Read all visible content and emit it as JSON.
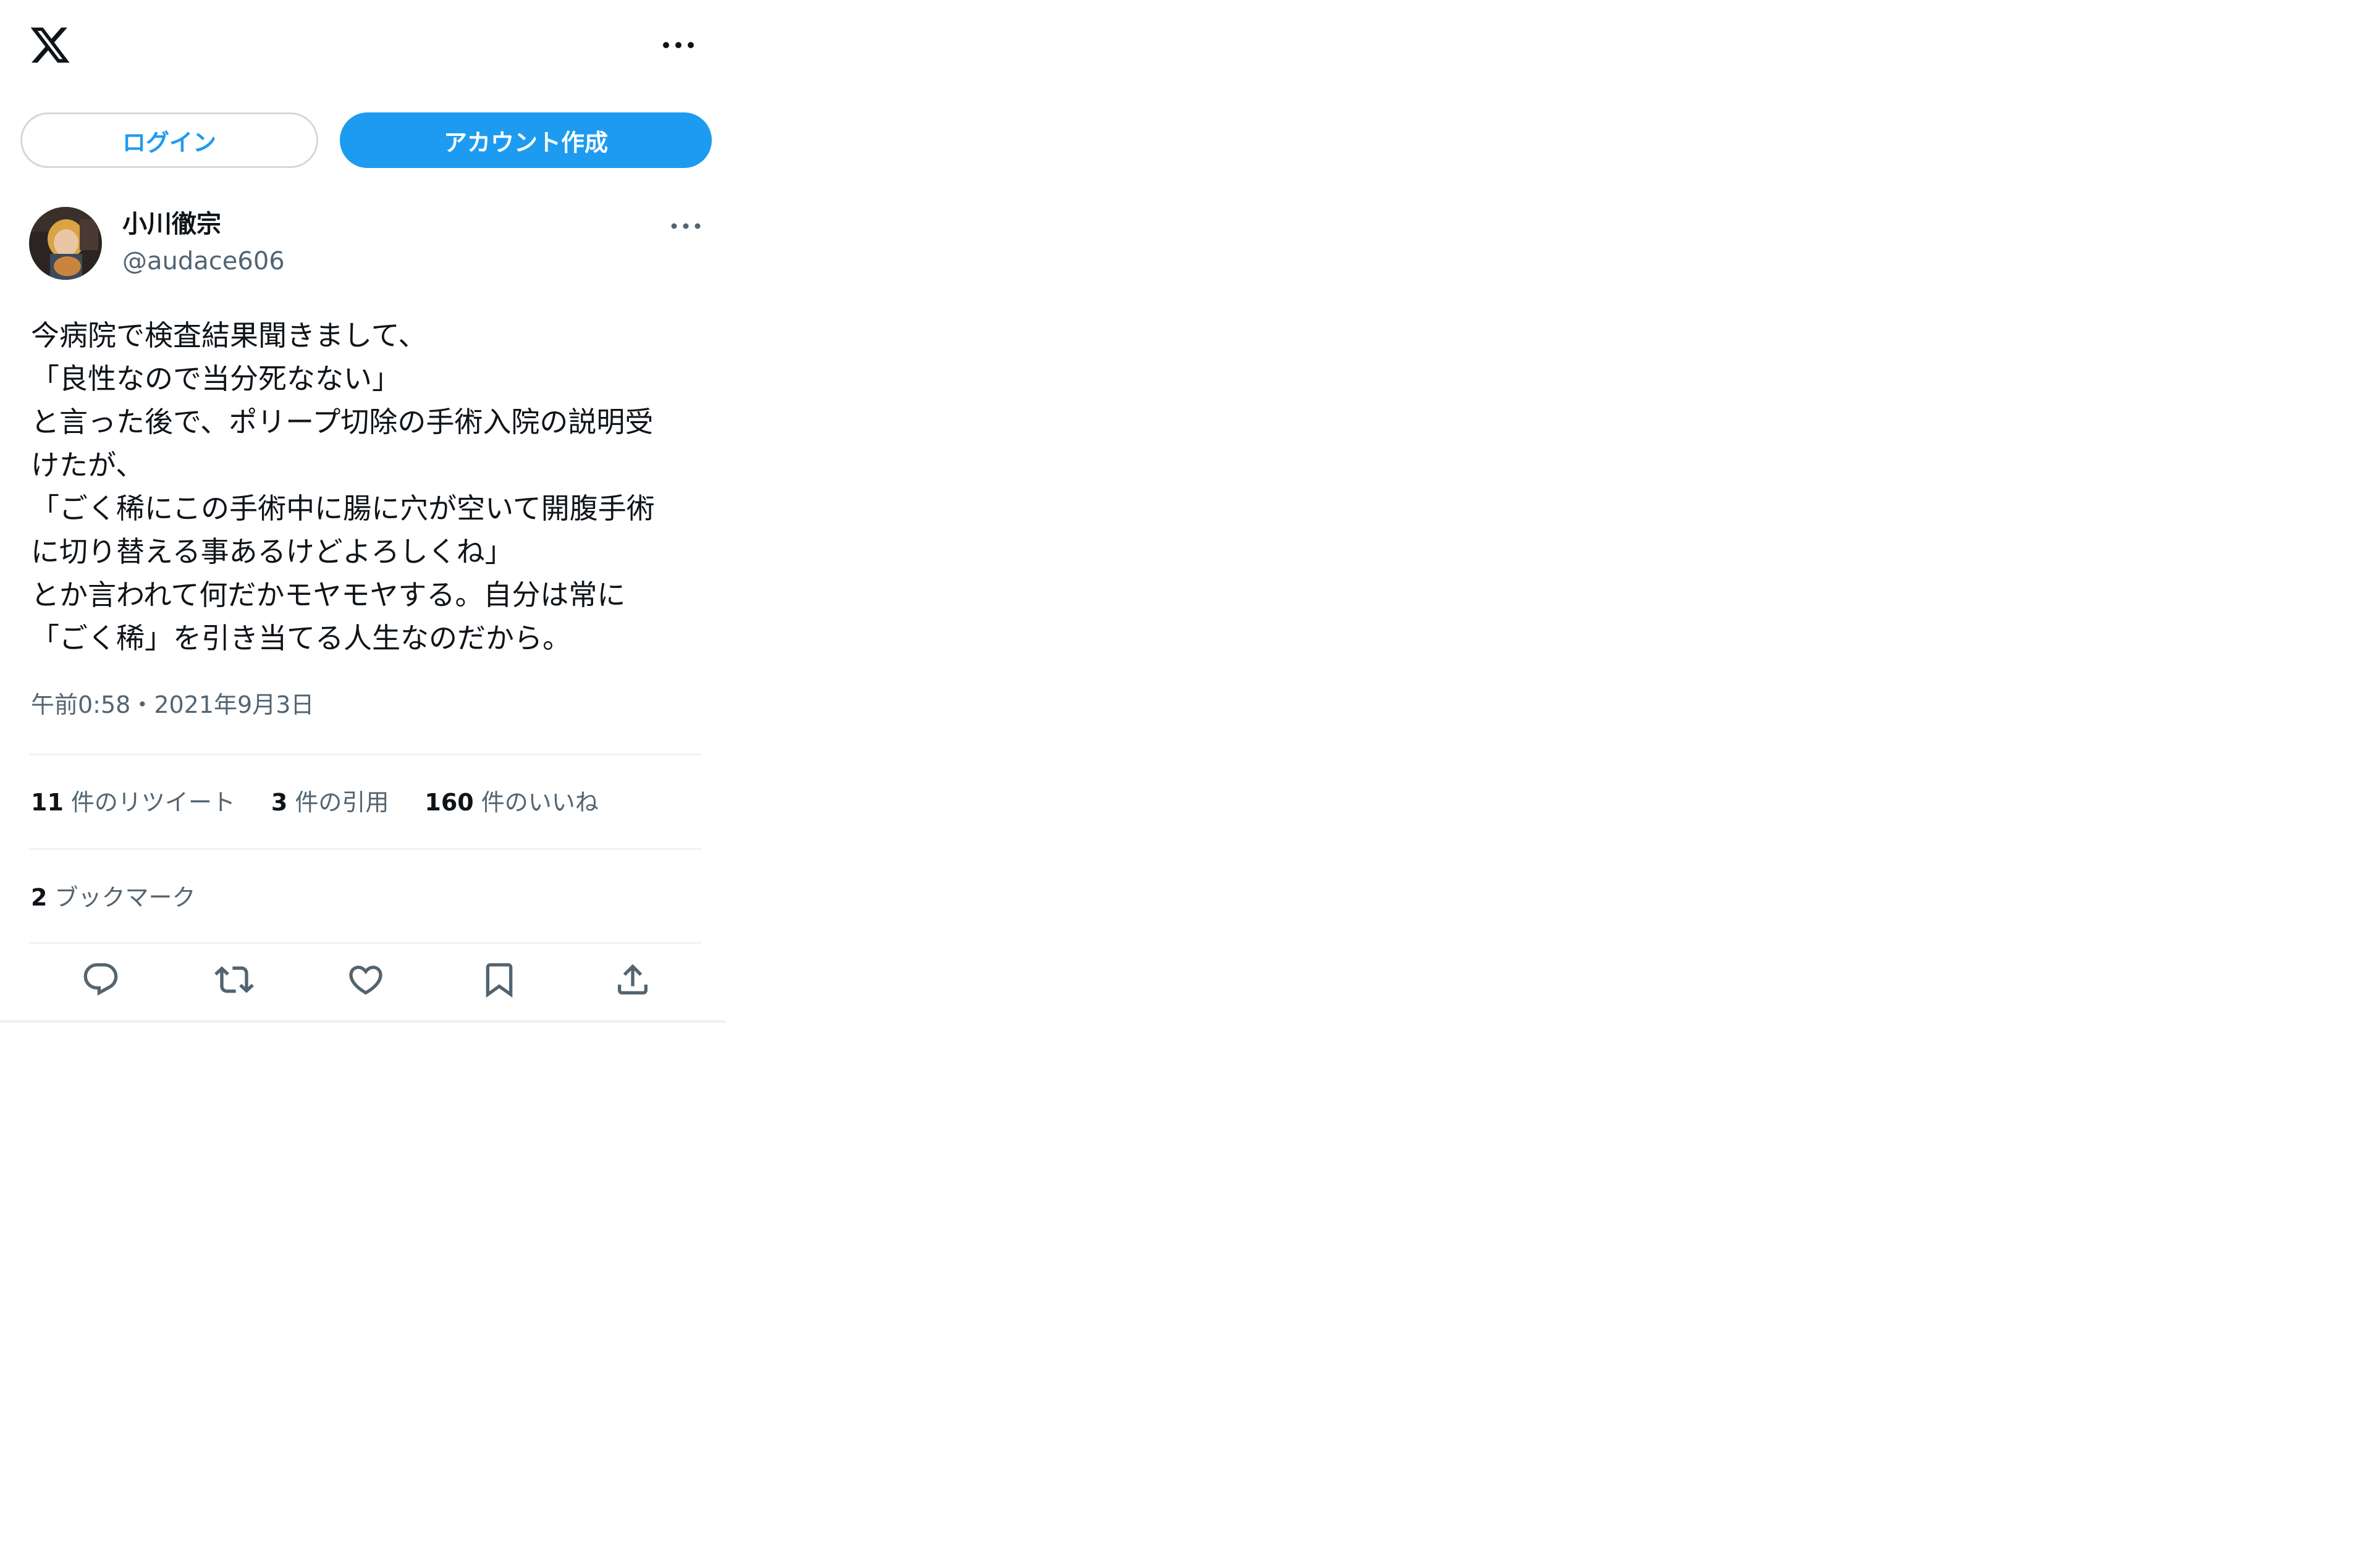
{
  "header": {
    "logo_icon": "x-logo-icon",
    "more_icon": "more-horizontal-icon"
  },
  "auth": {
    "login_label": "ログイン",
    "signup_label": "アカウント作成"
  },
  "tweet": {
    "author": {
      "display_name": "小川徹宗",
      "handle": "@audace606"
    },
    "text_lines": [
      "今病院で検査結果聞きまして、",
      "「良性なので当分死なない」",
      "と言った後で、ポリープ切除の手術入院の説明受",
      "けたが、",
      "「ごく稀にこの手術中に腸に穴が空いて開腹手術",
      "に切り替える事あるけどよろしくね」",
      "とか言われて何だかモヤモヤする。自分は常に",
      "「ごく稀」を引き当てる人生なのだから。"
    ],
    "timestamp": "午前0:58・2021年9月3日",
    "stats": {
      "retweets_count": "11",
      "retweets_label": "件のリツイート",
      "quotes_count": "3",
      "quotes_label": "件の引用",
      "likes_count": "160",
      "likes_label": "件のいいね",
      "bookmarks_count": "2",
      "bookmarks_label": "ブックマーク"
    },
    "actions": [
      "reply-icon",
      "retweet-icon",
      "like-icon",
      "bookmark-icon",
      "share-icon"
    ]
  },
  "colors": {
    "accent": "#1d9bf0",
    "text_primary": "#0f1419",
    "text_secondary": "#536471",
    "divider": "#eff3f4",
    "outline": "#cfd9de"
  }
}
